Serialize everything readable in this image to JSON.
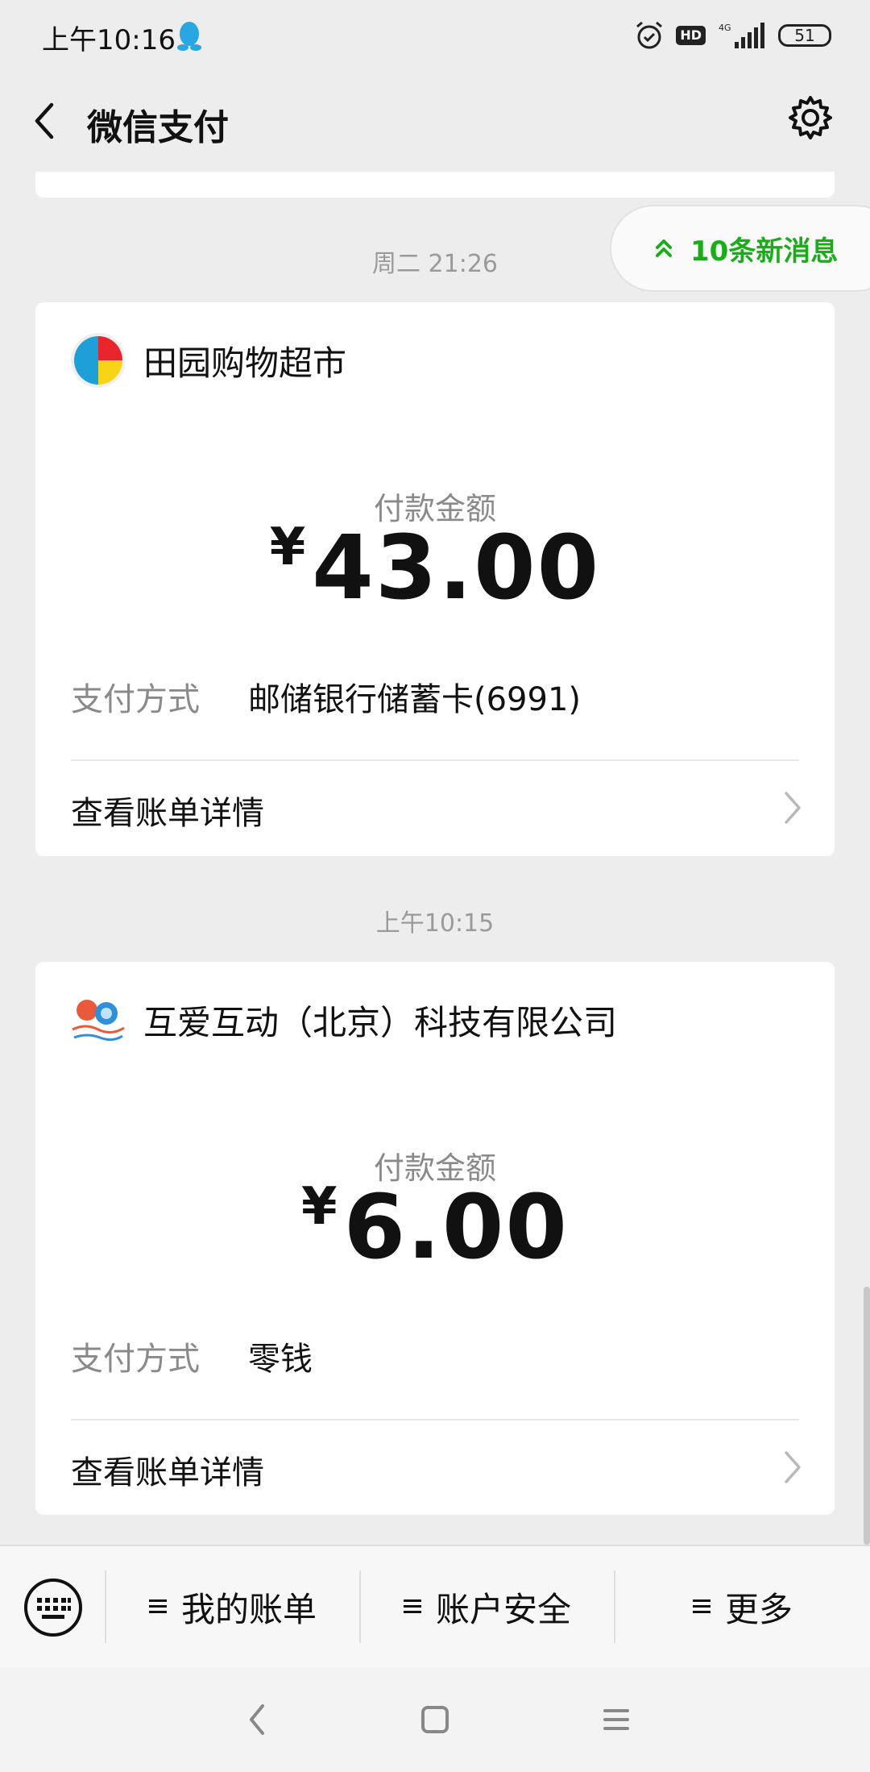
{
  "status_bar": {
    "time": "上午10:16",
    "hd": "HD",
    "network": "4G",
    "battery": "51"
  },
  "nav": {
    "title": "微信支付"
  },
  "new_messages": {
    "label": "10条新消息"
  },
  "payments": [
    {
      "time": "周二 21:26",
      "merchant": "田园购物超市",
      "amount_label": "付款金额",
      "currency": "¥",
      "amount": "43.00",
      "method_label": "支付方式",
      "method_value": "邮储银行储蓄卡(6991)",
      "detail_link": "查看账单详情"
    },
    {
      "time": "上午10:15",
      "merchant": "互爱互动（北京）科技有限公司",
      "amount_label": "付款金额",
      "currency": "¥",
      "amount": "6.00",
      "method_label": "支付方式",
      "method_value": "零钱",
      "detail_link": "查看账单详情"
    }
  ],
  "bottom_menu": {
    "items": [
      {
        "label": "我的账单"
      },
      {
        "label": "账户安全"
      },
      {
        "label": "更多"
      }
    ]
  },
  "colors": {
    "accent_green": "#1aad19",
    "background": "#ededed"
  }
}
